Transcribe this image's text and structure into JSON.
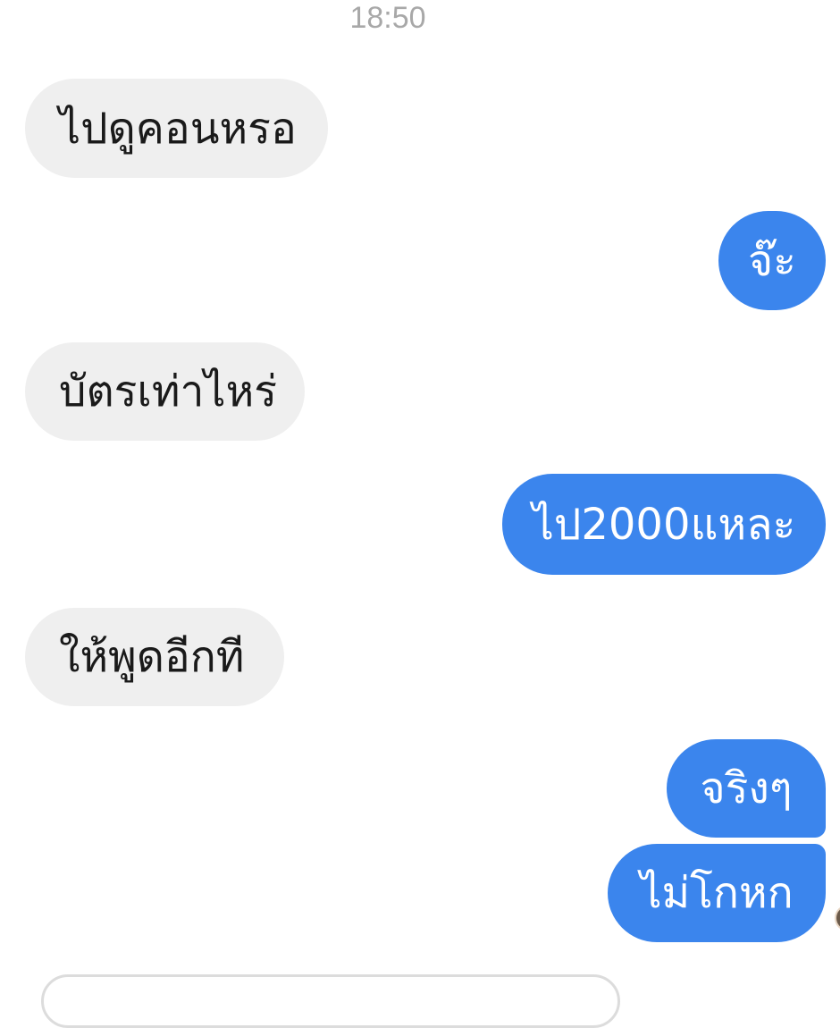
{
  "conversation": {
    "timestamp": "18:50",
    "messages": [
      {
        "direction": "incoming",
        "text": "ไปดูคอนหรอ"
      },
      {
        "direction": "outgoing",
        "text": "จ๊ะ"
      },
      {
        "direction": "incoming",
        "text": "บัตรเท่าไหร่"
      },
      {
        "direction": "outgoing",
        "text": "ไป2000แหละ"
      },
      {
        "direction": "incoming",
        "text": "ให้พูดอีกที"
      },
      {
        "direction": "outgoing",
        "text": "จริงๆ"
      },
      {
        "direction": "outgoing",
        "text": "ไม่โกหก"
      }
    ]
  },
  "colors": {
    "incoming_bubble": "#efefef",
    "outgoing_bubble": "#3b85ed",
    "timestamp_text": "#a8a8a8"
  }
}
